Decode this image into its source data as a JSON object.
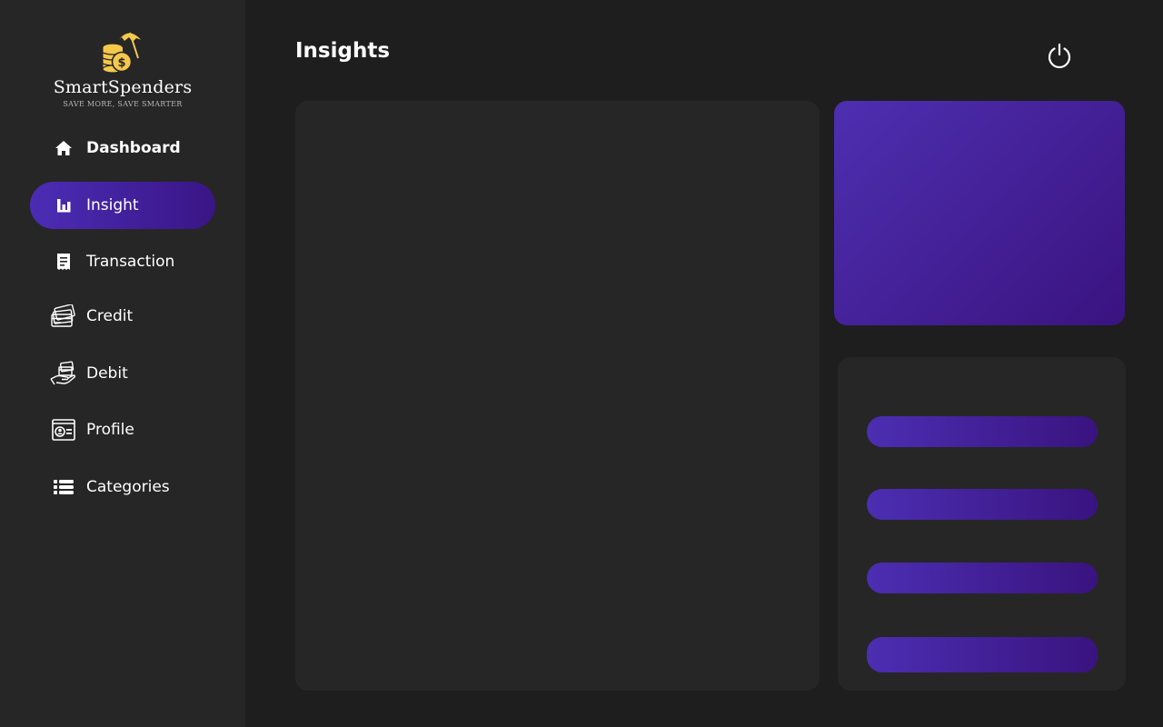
{
  "brand": {
    "name": "SmartSpenders",
    "tagline": "SAVE MORE, SAVE SMARTER",
    "logo_icon": "coins-umbrella-logo"
  },
  "sidebar": {
    "items": [
      {
        "label": "Dashboard",
        "icon": "home-icon"
      },
      {
        "label": "Insight",
        "icon": "bar-chart-icon",
        "active": true
      },
      {
        "label": "Transaction",
        "icon": "receipt-icon"
      },
      {
        "label": "Credit",
        "icon": "credit-cards-icon"
      },
      {
        "label": "Debit",
        "icon": "hand-card-icon"
      },
      {
        "label": "Profile",
        "icon": "id-card-icon"
      },
      {
        "label": "Categories",
        "icon": "list-icon"
      }
    ]
  },
  "header": {
    "title": "Insights",
    "power_icon": "power-icon"
  },
  "colors": {
    "background": "#1e1e1e",
    "sidebar": "#262626",
    "panel": "#262626",
    "accent_start": "#4b2db5",
    "accent_end": "#3a1586",
    "logo": "#f5c84c"
  }
}
